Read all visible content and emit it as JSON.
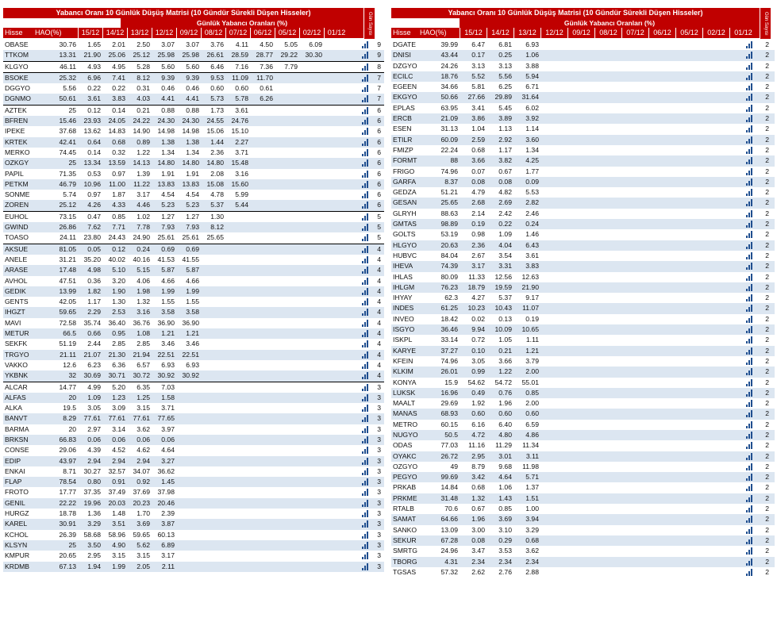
{
  "title": "Yabancı Oranı 10 Günlük Düşüş Matrisi  (10 Gündür Sürekli Düşen Hisseler)",
  "subtitle": "Günlük Yabancı Oranları (%)",
  "side_label": "Gün Sayısı",
  "headers": {
    "hisse": "Hisse",
    "hao": "HAO(%)",
    "dates": [
      "15/12",
      "14/12",
      "13/12",
      "12/12",
      "09/12",
      "08/12",
      "07/12",
      "06/12",
      "05/12",
      "02/12",
      "01/12"
    ]
  },
  "colors": {
    "accent": "#c00000",
    "stripe": "#dce6f1",
    "bar": "#1f4e8f"
  },
  "left_rows": [
    {
      "t": "OBASE",
      "h": "30.76",
      "v": [
        "1.65",
        "2.01",
        "2.50",
        "3.07",
        "3.07",
        "3.76",
        "4.11",
        "4.50",
        "5.05",
        "6.09"
      ],
      "n": "9"
    },
    {
      "t": "TTKOM",
      "h": "13.31",
      "v": [
        "21.90",
        "25.06",
        "25.12",
        "25.98",
        "25.98",
        "26.61",
        "28.59",
        "28.77",
        "29.22",
        "30.30"
      ],
      "n": "9"
    },
    {
      "t": "KLGYO",
      "h": "46.11",
      "v": [
        "4.93",
        "4.95",
        "5.28",
        "5.60",
        "5.60",
        "6.46",
        "7.16",
        "7.36",
        "7.79"
      ],
      "n": "8",
      "sep": true
    },
    {
      "t": "BSOKE",
      "h": "25.32",
      "v": [
        "6.96",
        "7.41",
        "8.12",
        "9.39",
        "9.39",
        "9.53",
        "11.09",
        "11.70"
      ],
      "n": "7",
      "sep": true
    },
    {
      "t": "DGGYO",
      "h": "5.56",
      "v": [
        "0.22",
        "0.22",
        "0.31",
        "0.46",
        "0.46",
        "0.60",
        "0.60",
        "0.61"
      ],
      "n": "7"
    },
    {
      "t": "DGNMO",
      "h": "50.61",
      "v": [
        "3.61",
        "3.83",
        "4.03",
        "4.41",
        "4.41",
        "5.73",
        "5.78",
        "6.26"
      ],
      "n": "7"
    },
    {
      "t": "AZTEK",
      "h": "25",
      "v": [
        "0.12",
        "0.14",
        "0.21",
        "0.88",
        "0.88",
        "1.73",
        "3.61"
      ],
      "n": "6",
      "sep": true
    },
    {
      "t": "BFREN",
      "h": "15.46",
      "v": [
        "23.93",
        "24.05",
        "24.22",
        "24.30",
        "24.30",
        "24.55",
        "24.76"
      ],
      "n": "6"
    },
    {
      "t": "IPEKE",
      "h": "37.68",
      "v": [
        "13.62",
        "14.83",
        "14.90",
        "14.98",
        "14.98",
        "15.06",
        "15.10"
      ],
      "n": "6"
    },
    {
      "t": "KRTEK",
      "h": "42.41",
      "v": [
        "0.64",
        "0.68",
        "0.89",
        "1.38",
        "1.38",
        "1.44",
        "2.27"
      ],
      "n": "6"
    },
    {
      "t": "MERKO",
      "h": "74.45",
      "v": [
        "0.14",
        "0.32",
        "1.22",
        "1.34",
        "1.34",
        "2.36",
        "3.71"
      ],
      "n": "6"
    },
    {
      "t": "OZKGY",
      "h": "25",
      "v": [
        "13.34",
        "13.59",
        "14.13",
        "14.80",
        "14.80",
        "14.80",
        "15.48"
      ],
      "n": "6"
    },
    {
      "t": "PAPIL",
      "h": "71.35",
      "v": [
        "0.53",
        "0.97",
        "1.39",
        "1.91",
        "1.91",
        "2.08",
        "3.16"
      ],
      "n": "6"
    },
    {
      "t": "PETKM",
      "h": "46.79",
      "v": [
        "10.96",
        "11.00",
        "11.22",
        "13.83",
        "13.83",
        "15.08",
        "15.60"
      ],
      "n": "6"
    },
    {
      "t": "SONME",
      "h": "5.74",
      "v": [
        "0.97",
        "1.87",
        "3.17",
        "4.54",
        "4.54",
        "4.78",
        "5.99"
      ],
      "n": "6"
    },
    {
      "t": "ZOREN",
      "h": "25.12",
      "v": [
        "4.26",
        "4.33",
        "4.46",
        "5.23",
        "5.23",
        "5.37",
        "5.44"
      ],
      "n": "6"
    },
    {
      "t": "EUHOL",
      "h": "73.15",
      "v": [
        "0.47",
        "0.85",
        "1.02",
        "1.27",
        "1.27",
        "1.30"
      ],
      "n": "5",
      "sep": true
    },
    {
      "t": "GWIND",
      "h": "26.86",
      "v": [
        "7.62",
        "7.71",
        "7.78",
        "7.93",
        "7.93",
        "8.12"
      ],
      "n": "5"
    },
    {
      "t": "TOASO",
      "h": "24.11",
      "v": [
        "23.80",
        "24.43",
        "24.90",
        "25.61",
        "25.61",
        "25.65"
      ],
      "n": "5"
    },
    {
      "t": "AKSUE",
      "h": "81.05",
      "v": [
        "0.05",
        "0.12",
        "0.24",
        "0.69",
        "0.69"
      ],
      "n": "4",
      "sep": true
    },
    {
      "t": "ANELE",
      "h": "31.21",
      "v": [
        "35.20",
        "40.02",
        "40.16",
        "41.53",
        "41.55"
      ],
      "n": "4"
    },
    {
      "t": "ARASE",
      "h": "17.48",
      "v": [
        "4.98",
        "5.10",
        "5.15",
        "5.87",
        "5.87"
      ],
      "n": "4"
    },
    {
      "t": "AVHOL",
      "h": "47.51",
      "v": [
        "0.36",
        "3.20",
        "4.06",
        "4.66",
        "4.66"
      ],
      "n": "4"
    },
    {
      "t": "GEDIK",
      "h": "13.99",
      "v": [
        "1.82",
        "1.90",
        "1.98",
        "1.99",
        "1.99"
      ],
      "n": "4"
    },
    {
      "t": "GENTS",
      "h": "42.05",
      "v": [
        "1.17",
        "1.30",
        "1.32",
        "1.55",
        "1.55"
      ],
      "n": "4"
    },
    {
      "t": "IHGZT",
      "h": "59.65",
      "v": [
        "2.29",
        "2.53",
        "3.16",
        "3.58",
        "3.58"
      ],
      "n": "4"
    },
    {
      "t": "MAVI",
      "h": "72.58",
      "v": [
        "35.74",
        "36.40",
        "36.76",
        "36.90",
        "36.90"
      ],
      "n": "4"
    },
    {
      "t": "METUR",
      "h": "66.5",
      "v": [
        "0.66",
        "0.95",
        "1.08",
        "1.21",
        "1.21"
      ],
      "n": "4"
    },
    {
      "t": "SEKFK",
      "h": "51.19",
      "v": [
        "2.44",
        "2.85",
        "2.85",
        "3.46",
        "3.46"
      ],
      "n": "4"
    },
    {
      "t": "TRGYO",
      "h": "21.11",
      "v": [
        "21.07",
        "21.30",
        "21.94",
        "22.51",
        "22.51"
      ],
      "n": "4"
    },
    {
      "t": "VAKKO",
      "h": "12.6",
      "v": [
        "6.23",
        "6.36",
        "6.57",
        "6.93",
        "6.93"
      ],
      "n": "4"
    },
    {
      "t": "YKBNK",
      "h": "32",
      "v": [
        "30.69",
        "30.71",
        "30.72",
        "30.92",
        "30.92"
      ],
      "n": "4"
    },
    {
      "t": "ALCAR",
      "h": "14.77",
      "v": [
        "4.99",
        "5.20",
        "6.35",
        "7.03"
      ],
      "n": "3",
      "sep": true
    },
    {
      "t": "ALFAS",
      "h": "20",
      "v": [
        "1.09",
        "1.23",
        "1.25",
        "1.58"
      ],
      "n": "3"
    },
    {
      "t": "ALKA",
      "h": "19.5",
      "v": [
        "3.05",
        "3.09",
        "3.15",
        "3.71"
      ],
      "n": "3"
    },
    {
      "t": "BANVT",
      "h": "8.29",
      "v": [
        "77.61",
        "77.61",
        "77.61",
        "77.65"
      ],
      "n": "3"
    },
    {
      "t": "BARMA",
      "h": "20",
      "v": [
        "2.97",
        "3.14",
        "3.62",
        "3.97"
      ],
      "n": "3"
    },
    {
      "t": "BRKSN",
      "h": "66.83",
      "v": [
        "0.06",
        "0.06",
        "0.06",
        "0.06"
      ],
      "n": "3"
    },
    {
      "t": "CONSE",
      "h": "29.06",
      "v": [
        "4.39",
        "4.52",
        "4.62",
        "4.64"
      ],
      "n": "3"
    },
    {
      "t": "EDIP",
      "h": "43.97",
      "v": [
        "2.94",
        "2.94",
        "2.94",
        "3.27"
      ],
      "n": "3"
    },
    {
      "t": "ENKAI",
      "h": "8.71",
      "v": [
        "30.27",
        "32.57",
        "34.07",
        "36.62"
      ],
      "n": "3"
    },
    {
      "t": "FLAP",
      "h": "78.54",
      "v": [
        "0.80",
        "0.91",
        "0.92",
        "1.45"
      ],
      "n": "3"
    },
    {
      "t": "FROTO",
      "h": "17.77",
      "v": [
        "37.35",
        "37.49",
        "37.69",
        "37.98"
      ],
      "n": "3"
    },
    {
      "t": "GENIL",
      "h": "22.22",
      "v": [
        "19.96",
        "20.03",
        "20.23",
        "20.46"
      ],
      "n": "3"
    },
    {
      "t": "HURGZ",
      "h": "18.78",
      "v": [
        "1.36",
        "1.48",
        "1.70",
        "2.39"
      ],
      "n": "3"
    },
    {
      "t": "KAREL",
      "h": "30.91",
      "v": [
        "3.29",
        "3.51",
        "3.69",
        "3.87"
      ],
      "n": "3"
    },
    {
      "t": "KCHOL",
      "h": "26.39",
      "v": [
        "58.68",
        "58.96",
        "59.65",
        "60.13"
      ],
      "n": "3"
    },
    {
      "t": "KLSYN",
      "h": "25",
      "v": [
        "3.50",
        "4.90",
        "5.62",
        "6.89"
      ],
      "n": "3"
    },
    {
      "t": "KMPUR",
      "h": "20.65",
      "v": [
        "2.95",
        "3.15",
        "3.15",
        "3.17"
      ],
      "n": "3"
    },
    {
      "t": "KRDMB",
      "h": "67.13",
      "v": [
        "1.94",
        "1.99",
        "2.05",
        "2.11"
      ],
      "n": "3"
    }
  ],
  "right_rows": [
    {
      "t": "DGATE",
      "h": "39.99",
      "v": [
        "6.47",
        "6.81",
        "6.93"
      ],
      "n": "2"
    },
    {
      "t": "DNISI",
      "h": "43.44",
      "v": [
        "0.17",
        "0.25",
        "1.06"
      ],
      "n": "2"
    },
    {
      "t": "DZGYO",
      "h": "24.26",
      "v": [
        "3.13",
        "3.13",
        "3.88"
      ],
      "n": "2"
    },
    {
      "t": "ECILC",
      "h": "18.76",
      "v": [
        "5.52",
        "5.56",
        "5.94"
      ],
      "n": "2"
    },
    {
      "t": "EGEEN",
      "h": "34.66",
      "v": [
        "5.81",
        "6.25",
        "6.71"
      ],
      "n": "2"
    },
    {
      "t": "EKGYO",
      "h": "50.66",
      "v": [
        "27.66",
        "29.89",
        "31.64"
      ],
      "n": "2"
    },
    {
      "t": "EPLAS",
      "h": "63.95",
      "v": [
        "3.41",
        "5.45",
        "6.02"
      ],
      "n": "2"
    },
    {
      "t": "ERCB",
      "h": "21.09",
      "v": [
        "3.86",
        "3.89",
        "3.92"
      ],
      "n": "2"
    },
    {
      "t": "ESEN",
      "h": "31.13",
      "v": [
        "1.04",
        "1.13",
        "1.14"
      ],
      "n": "2"
    },
    {
      "t": "ETILR",
      "h": "60.09",
      "v": [
        "2.59",
        "2.92",
        "3.60"
      ],
      "n": "2"
    },
    {
      "t": "FMIZP",
      "h": "22.24",
      "v": [
        "0.68",
        "1.17",
        "1.34"
      ],
      "n": "2"
    },
    {
      "t": "FORMT",
      "h": "88",
      "v": [
        "3.66",
        "3.82",
        "4.25"
      ],
      "n": "2"
    },
    {
      "t": "FRIGO",
      "h": "74.96",
      "v": [
        "0.07",
        "0.67",
        "1.77"
      ],
      "n": "2"
    },
    {
      "t": "GARFA",
      "h": "8.37",
      "v": [
        "0.08",
        "0.08",
        "0.09"
      ],
      "n": "2"
    },
    {
      "t": "GEDZA",
      "h": "51.21",
      "v": [
        "4.79",
        "4.82",
        "5.53"
      ],
      "n": "2"
    },
    {
      "t": "GESAN",
      "h": "25.65",
      "v": [
        "2.68",
        "2.69",
        "2.82"
      ],
      "n": "2"
    },
    {
      "t": "GLRYH",
      "h": "88.63",
      "v": [
        "2.14",
        "2.42",
        "2.46"
      ],
      "n": "2"
    },
    {
      "t": "GMTAS",
      "h": "98.89",
      "v": [
        "0.19",
        "0.22",
        "0.24"
      ],
      "n": "2"
    },
    {
      "t": "GOLTS",
      "h": "53.19",
      "v": [
        "0.98",
        "1.09",
        "1.46"
      ],
      "n": "2"
    },
    {
      "t": "HLGYO",
      "h": "20.63",
      "v": [
        "2.36",
        "4.04",
        "6.43"
      ],
      "n": "2"
    },
    {
      "t": "HUBVC",
      "h": "84.04",
      "v": [
        "2.67",
        "3.54",
        "3.61"
      ],
      "n": "2"
    },
    {
      "t": "IHEVA",
      "h": "74.39",
      "v": [
        "3.17",
        "3.31",
        "3.83"
      ],
      "n": "2"
    },
    {
      "t": "IHLAS",
      "h": "80.09",
      "v": [
        "11.33",
        "12.56",
        "12.63"
      ],
      "n": "2"
    },
    {
      "t": "IHLGM",
      "h": "76.23",
      "v": [
        "18.79",
        "19.59",
        "21.90"
      ],
      "n": "2"
    },
    {
      "t": "IHYAY",
      "h": "62.3",
      "v": [
        "4.27",
        "5.37",
        "9.17"
      ],
      "n": "2"
    },
    {
      "t": "INDES",
      "h": "61.25",
      "v": [
        "10.23",
        "10.43",
        "11.07"
      ],
      "n": "2"
    },
    {
      "t": "INVEO",
      "h": "18.42",
      "v": [
        "0.02",
        "0.13",
        "0.19"
      ],
      "n": "2"
    },
    {
      "t": "ISGYO",
      "h": "36.46",
      "v": [
        "9.94",
        "10.09",
        "10.65"
      ],
      "n": "2"
    },
    {
      "t": "ISKPL",
      "h": "33.14",
      "v": [
        "0.72",
        "1.05",
        "1.11"
      ],
      "n": "2"
    },
    {
      "t": "KARYE",
      "h": "37.27",
      "v": [
        "0.10",
        "0.21",
        "1.21"
      ],
      "n": "2"
    },
    {
      "t": "KFEIN",
      "h": "74.96",
      "v": [
        "3.05",
        "3.66",
        "3.79"
      ],
      "n": "2"
    },
    {
      "t": "KLKIM",
      "h": "26.01",
      "v": [
        "0.99",
        "1.22",
        "2.00"
      ],
      "n": "2"
    },
    {
      "t": "KONYA",
      "h": "15.9",
      "v": [
        "54.62",
        "54.72",
        "55.01"
      ],
      "n": "2"
    },
    {
      "t": "LUKSK",
      "h": "16.96",
      "v": [
        "0.49",
        "0.76",
        "0.85"
      ],
      "n": "2"
    },
    {
      "t": "MAALT",
      "h": "29.69",
      "v": [
        "1.92",
        "1.96",
        "2.00"
      ],
      "n": "2"
    },
    {
      "t": "MANAS",
      "h": "68.93",
      "v": [
        "0.60",
        "0.60",
        "0.60"
      ],
      "n": "2"
    },
    {
      "t": "METRO",
      "h": "60.15",
      "v": [
        "6.16",
        "6.40",
        "6.59"
      ],
      "n": "2"
    },
    {
      "t": "NUGYO",
      "h": "50.5",
      "v": [
        "4.72",
        "4.80",
        "4.86"
      ],
      "n": "2"
    },
    {
      "t": "ODAS",
      "h": "77.03",
      "v": [
        "11.16",
        "11.29",
        "11.34"
      ],
      "n": "2"
    },
    {
      "t": "OYAKC",
      "h": "26.72",
      "v": [
        "2.95",
        "3.01",
        "3.11"
      ],
      "n": "2"
    },
    {
      "t": "OZGYO",
      "h": "49",
      "v": [
        "8.79",
        "9.68",
        "11.98"
      ],
      "n": "2"
    },
    {
      "t": "PEGYO",
      "h": "99.69",
      "v": [
        "3.42",
        "4.64",
        "5.71"
      ],
      "n": "2"
    },
    {
      "t": "PRKAB",
      "h": "14.84",
      "v": [
        "0.68",
        "1.06",
        "1.37"
      ],
      "n": "2"
    },
    {
      "t": "PRKME",
      "h": "31.48",
      "v": [
        "1.32",
        "1.43",
        "1.51"
      ],
      "n": "2"
    },
    {
      "t": "RTALB",
      "h": "70.6",
      "v": [
        "0.67",
        "0.85",
        "1.00"
      ],
      "n": "2"
    },
    {
      "t": "SAMAT",
      "h": "64.66",
      "v": [
        "1.96",
        "3.69",
        "3.94"
      ],
      "n": "2"
    },
    {
      "t": "SANKO",
      "h": "13.09",
      "v": [
        "3.00",
        "3.10",
        "3.29"
      ],
      "n": "2"
    },
    {
      "t": "SEKUR",
      "h": "67.28",
      "v": [
        "0.08",
        "0.29",
        "0.68"
      ],
      "n": "2"
    },
    {
      "t": "SMRTG",
      "h": "24.96",
      "v": [
        "3.47",
        "3.53",
        "3.62"
      ],
      "n": "2"
    },
    {
      "t": "TBORG",
      "h": "4.31",
      "v": [
        "2.34",
        "2.34",
        "2.34"
      ],
      "n": "2"
    },
    {
      "t": "TGSAS",
      "h": "57.32",
      "v": [
        "2.62",
        "2.76",
        "2.88"
      ],
      "n": "2"
    }
  ]
}
